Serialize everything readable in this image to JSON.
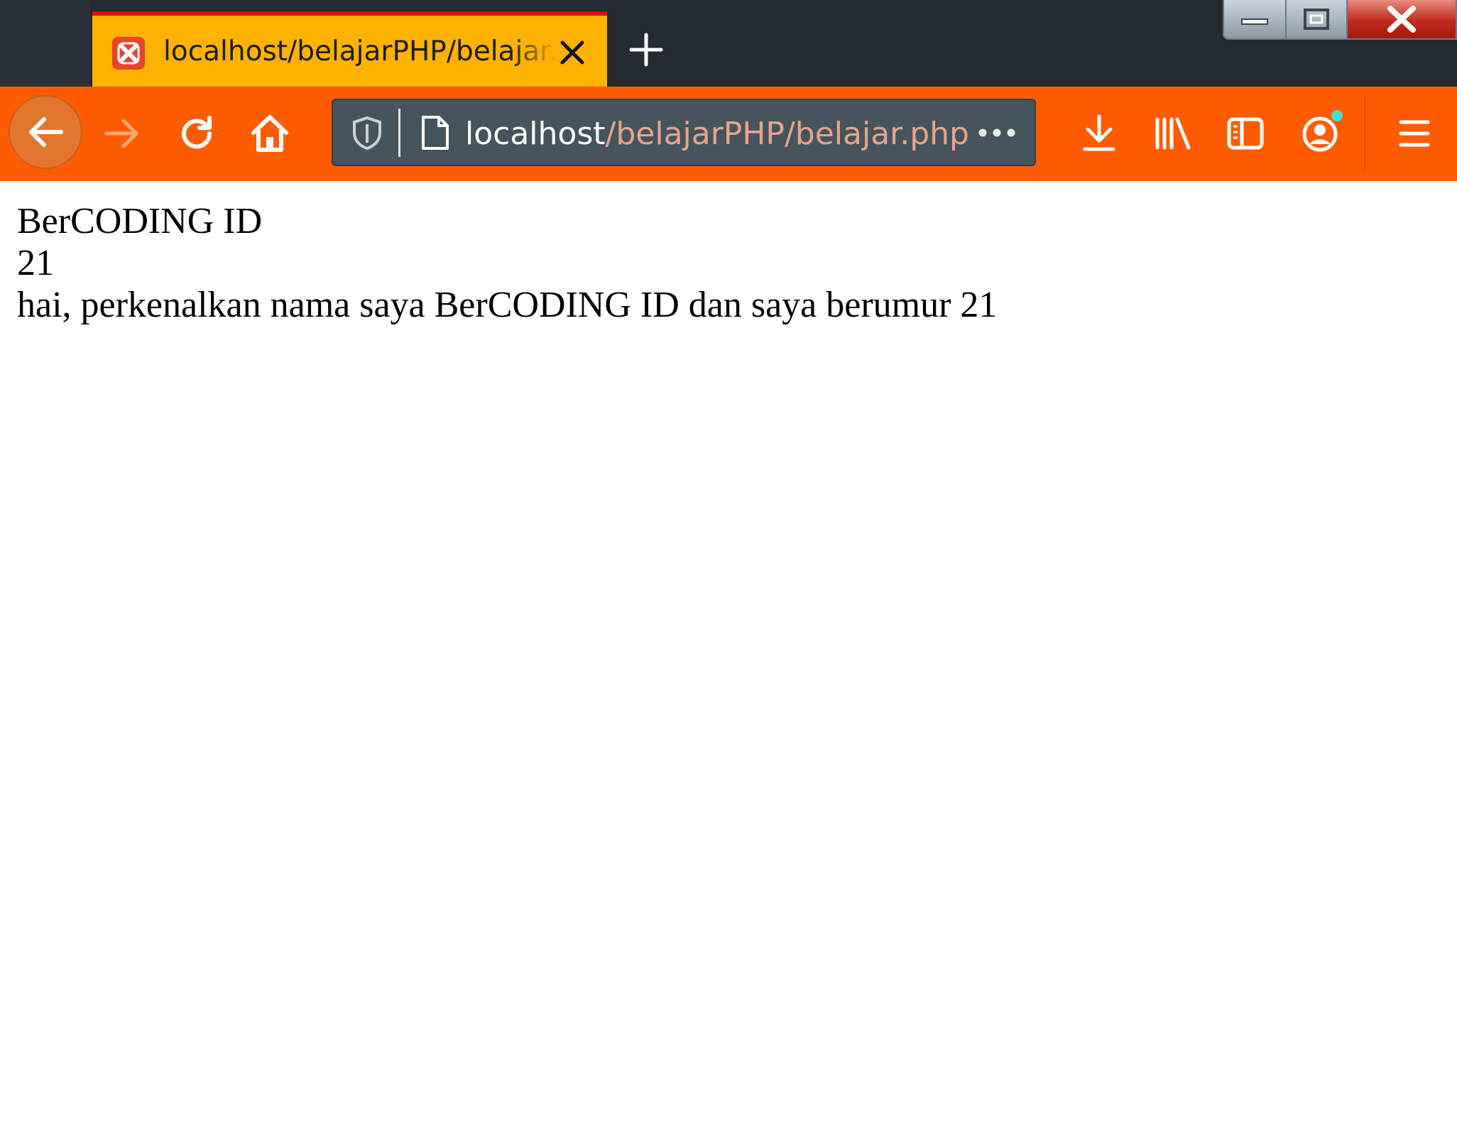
{
  "browser": {
    "tab": {
      "title": "localhost/belajarPHP/belajar.php",
      "favicon": "xampp-icon",
      "close_icon": "close-icon"
    },
    "new_tab_icon": "plus-icon",
    "window_controls": [
      "minimize-icon",
      "restore-icon",
      "close-icon"
    ],
    "nav": {
      "back_icon": "arrow-left-icon",
      "forward_icon": "arrow-right-icon",
      "reload_icon": "reload-icon",
      "home_icon": "home-icon"
    },
    "url": {
      "host": "localhost",
      "path": "/belajarPHP/belajar.php",
      "shield_icon": "shield-icon",
      "page_icon": "page-icon",
      "more_icon": "more-dots-icon"
    },
    "toolbar_icons": [
      "download-icon",
      "library-icon",
      "sidebar-icon",
      "account-icon",
      "menu-icon"
    ],
    "colors": {
      "titlebar": "#242b31",
      "tab_active": "#ffb300",
      "tab_accent": "#e0001a",
      "navbar": "#ff5b00",
      "urlbar": "#45545d",
      "url_path": "#e8a38a",
      "notification_dot": "#49e1d4"
    }
  },
  "page": {
    "lines": [
      "BerCODING ID",
      "21",
      "hai, perkenalkan nama saya BerCODING ID dan saya berumur 21"
    ]
  }
}
